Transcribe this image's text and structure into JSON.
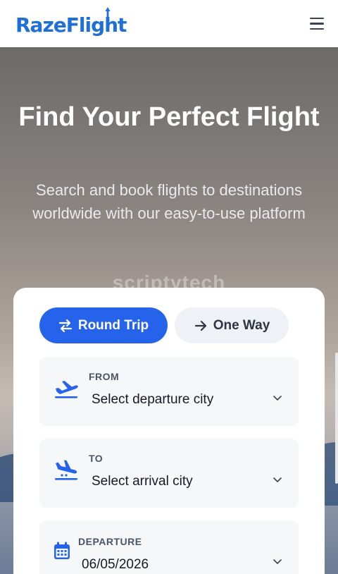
{
  "header": {
    "logo_text": "RazeFlight",
    "brand_color": "#1f6fd6",
    "menu_icon": "hamburger-icon"
  },
  "hero": {
    "title": "Find Your Perfect Flight",
    "subtitle": "Search and book flights to destinations worldwide with our easy-to-use platform",
    "watermark": "scriptytech"
  },
  "search": {
    "trip_types": [
      {
        "label": "Round Trip",
        "icon": "swap-arrows-icon",
        "selected": true
      },
      {
        "label": "One Way",
        "icon": "arrow-right-icon",
        "selected": false
      }
    ],
    "accent_color": "#2563eb",
    "from": {
      "label": "FROM",
      "value": "Select departure city",
      "icon": "plane-takeoff-icon"
    },
    "to": {
      "label": "TO",
      "value": "Select arrival city",
      "icon": "plane-landing-icon"
    },
    "departure": {
      "label": "DEPARTURE",
      "value": "06/05/2026",
      "icon": "calendar-icon"
    }
  }
}
